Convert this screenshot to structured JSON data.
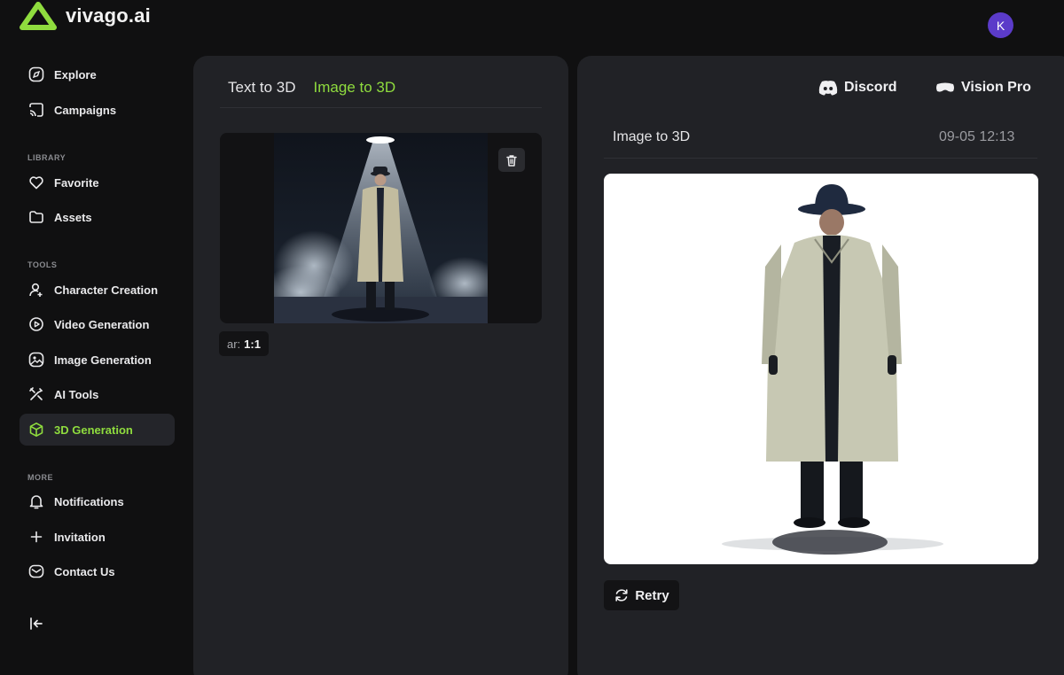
{
  "brand": {
    "name": "vivago.ai",
    "accent": "#8fdc3e"
  },
  "user": {
    "avatar_initial": "K",
    "avatar_color": "#5b3bc9"
  },
  "sidebar": {
    "items_top": [
      {
        "label": "Explore",
        "icon": "compass-icon"
      },
      {
        "label": "Campaigns",
        "icon": "cast-icon"
      }
    ],
    "library_label": "LIBRARY",
    "library_items": [
      {
        "label": "Favorite",
        "icon": "heart-icon"
      },
      {
        "label": "Assets",
        "icon": "folder-icon"
      }
    ],
    "tools_label": "TOOLS",
    "tools_items": [
      {
        "label": "Character Creation",
        "icon": "user-plus-icon"
      },
      {
        "label": "Video Generation",
        "icon": "video-icon"
      },
      {
        "label": "Image Generation",
        "icon": "image-icon"
      },
      {
        "label": "AI Tools",
        "icon": "tools-icon"
      },
      {
        "label": "3D Generation",
        "icon": "cube-icon",
        "active": true
      }
    ],
    "more_label": "MORE",
    "more_items": [
      {
        "label": "Notifications",
        "icon": "bell-icon"
      },
      {
        "label": "Invitation",
        "icon": "plus-icon"
      },
      {
        "label": "Contact Us",
        "icon": "mail-icon"
      }
    ]
  },
  "left_panel": {
    "tabs": [
      {
        "label": "Text to 3D",
        "active": false
      },
      {
        "label": "Image to 3D",
        "active": true
      }
    ],
    "aspect_key": "ar:",
    "aspect_value": "1:1"
  },
  "right_panel": {
    "discord_label": "Discord",
    "vision_pro_label": "Vision Pro",
    "result_title": "Image to 3D",
    "result_time": "09-05 12:13",
    "retry_label": "Retry"
  }
}
